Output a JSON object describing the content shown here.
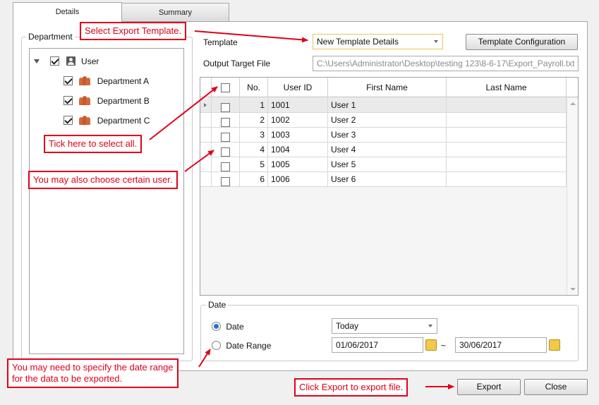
{
  "tabs": [
    {
      "label": "Details"
    },
    {
      "label": "Summary"
    }
  ],
  "department": {
    "title": "Department",
    "root": {
      "label": "User",
      "checked": true
    },
    "children": [
      {
        "label": "Department A",
        "checked": true
      },
      {
        "label": "Department B",
        "checked": true
      },
      {
        "label": "Department C",
        "checked": true
      }
    ]
  },
  "template": {
    "label": "Template",
    "selected": "New Template Details",
    "config_button": "Template Configuration"
  },
  "output": {
    "label": "Output Target File",
    "value": "C:\\Users\\Administrator\\Desktop\\testing 123\\8-6-17\\Export_Payroll.txt"
  },
  "grid": {
    "columns": [
      "No.",
      "User ID",
      "First Name",
      "Last Name"
    ],
    "rows": [
      {
        "no": "1",
        "user_id": "1001",
        "first_name": "User 1",
        "last_name": "",
        "checked": false
      },
      {
        "no": "2",
        "user_id": "1002",
        "first_name": "User 2",
        "last_name": "",
        "checked": false
      },
      {
        "no": "3",
        "user_id": "1003",
        "first_name": "User 3",
        "last_name": "",
        "checked": false
      },
      {
        "no": "4",
        "user_id": "1004",
        "first_name": "User 4",
        "last_name": "",
        "checked": false
      },
      {
        "no": "5",
        "user_id": "1005",
        "first_name": "User 5",
        "last_name": "",
        "checked": false
      },
      {
        "no": "6",
        "user_id": "1006",
        "first_name": "User 6",
        "last_name": "",
        "checked": false
      }
    ]
  },
  "date": {
    "title": "Date",
    "date_option": "Date",
    "date_value": "Today",
    "range_option": "Date Range",
    "range_from": "01/06/2017",
    "range_sep": "~",
    "range_to": "30/06/2017",
    "selected_option": "Date"
  },
  "buttons": {
    "export": "Export",
    "close": "Close"
  },
  "callouts": {
    "select_template": "Select Export Template.",
    "tick_all": "Tick here to select all.",
    "choose_user": "You may also choose certain user.",
    "date_range_line1": "You may need to specify the date range",
    "date_range_line2": "for the data to be exported.",
    "export": "Click Export to export file."
  },
  "colors": {
    "callout": "#e0001a",
    "accent": "#2a6fd6"
  }
}
